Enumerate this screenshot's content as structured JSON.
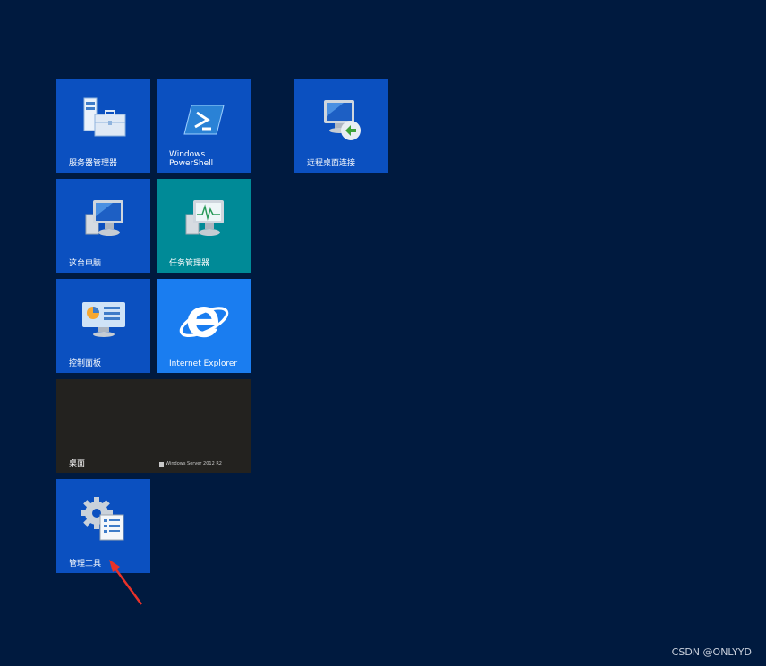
{
  "tiles": {
    "server_manager": "服务器管理器",
    "powershell": "Windows\nPowerShell",
    "remote_desktop": "远程桌面连接",
    "this_pc": "这台电脑",
    "task_manager": "任务管理器",
    "control_panel": "控制面板",
    "internet_explorer": "Internet Explorer",
    "desktop": "桌面",
    "desktop_watermark": "Windows Server 2012 R2",
    "admin_tools": "管理工具"
  },
  "footer": {
    "credit": "CSDN @ONLYYD"
  },
  "colors": {
    "background": "#001a3f",
    "tile_blue": "#0b50c0",
    "tile_teal": "#008a97",
    "tile_ie": "#1a7df0",
    "tile_desktop": "#23221f",
    "annotation_arrow": "#e8322a"
  },
  "icons": [
    "server-manager-icon",
    "powershell-icon",
    "remote-desktop-icon",
    "this-pc-icon",
    "task-manager-icon",
    "control-panel-icon",
    "internet-explorer-icon",
    "windows-logo-icon",
    "admin-tools-icon"
  ]
}
